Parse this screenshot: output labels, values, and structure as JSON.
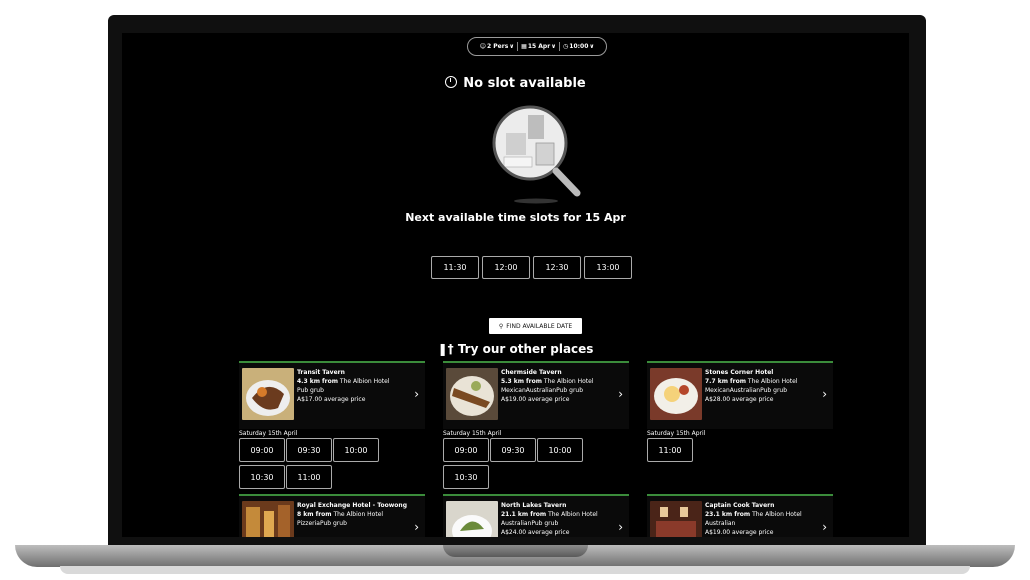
{
  "selector": {
    "persons": "2 Pers",
    "date": "15 Apr",
    "time": "10:00"
  },
  "no_slot_title": "No slot available",
  "next_title": "Next available time slots for 15 Apr",
  "next_slots": [
    "11:30",
    "12:00",
    "12:30",
    "13:00"
  ],
  "find_button": "FIND AVAILABLE DATE",
  "other_title": "Try our other places",
  "places": [
    {
      "name": "Transit Tavern",
      "distance": "4.3 km from",
      "from_place": "The Albion Hotel",
      "cuisine": "Pub grub",
      "price": "A$17.00 average price",
      "date_label": "Saturday 15th April",
      "slots": [
        "09:00",
        "09:30",
        "10:00",
        "10:30",
        "11:00"
      ]
    },
    {
      "name": "Chermside Tavern",
      "distance": "5.3 km from",
      "from_place": "The Albion Hotel",
      "cuisine": "MexicanAustralianPub grub",
      "price": "A$19.00 average price",
      "date_label": "Saturday 15th April",
      "slots": [
        "09:00",
        "09:30",
        "10:00",
        "10:30"
      ]
    },
    {
      "name": "Stones Corner Hotel",
      "distance": "7.7 km from",
      "from_place": "The Albion Hotel",
      "cuisine": "MexicanAustralianPub grub",
      "price": "A$28.00 average price",
      "date_label": "Saturday 15th April",
      "slots": [
        "11:00"
      ]
    },
    {
      "name": "Royal Exchange Hotel - Toowong",
      "distance": "8 km from",
      "from_place": "The Albion Hotel",
      "cuisine": "PizzeriaPub grub",
      "price": "",
      "date_label": "",
      "slots": []
    },
    {
      "name": "North Lakes Tavern",
      "distance": "21.1 km from",
      "from_place": "The Albion Hotel",
      "cuisine": "AustralianPub grub",
      "price": "A$24.00 average price",
      "date_label": "",
      "slots": []
    },
    {
      "name": "Captain Cook Tavern",
      "distance": "23.1 km from",
      "from_place": "The Albion Hotel",
      "cuisine": "Australian",
      "price": "A$19.00 average price",
      "date_label": "",
      "slots": []
    }
  ],
  "colors": {
    "accent_green": "#3b8c3b",
    "background": "#000000"
  }
}
